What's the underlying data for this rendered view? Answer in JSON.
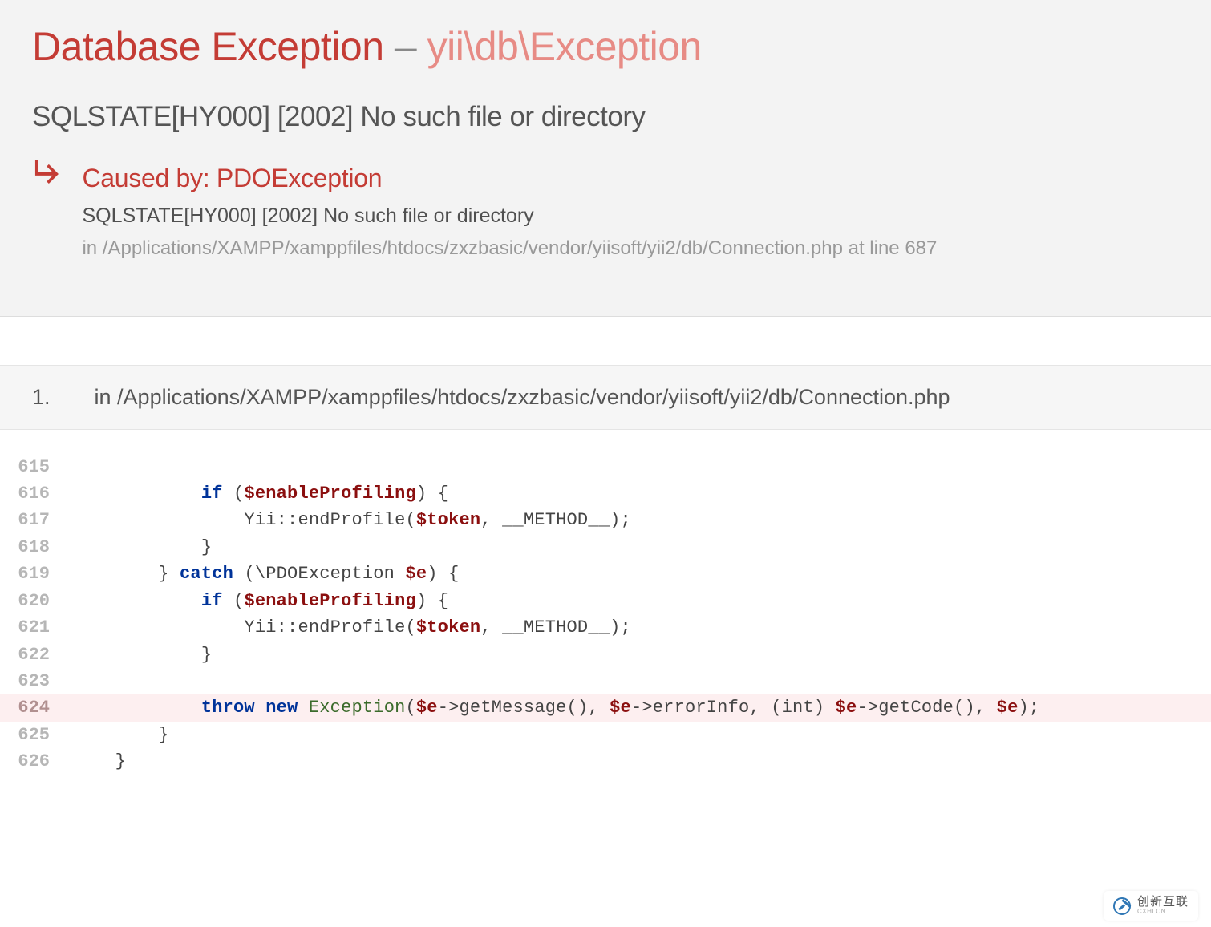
{
  "exception": {
    "name": "Database Exception",
    "separator": " – ",
    "class": "yii\\db\\Exception"
  },
  "message": "SQLSTATE[HY000] [2002] No such file or directory",
  "caused_by": {
    "label": "Caused by: PDOException",
    "message": "SQLSTATE[HY000] [2002] No such file or directory",
    "location": "in /Applications/XAMPP/xamppfiles/htdocs/zxzbasic/vendor/yiisoft/yii2/db/Connection.php at line 687"
  },
  "stack": {
    "index": "1.",
    "in": "in ",
    "path": "/Applications/XAMPP/xamppfiles/htdocs/zxzbasic/vendor/yiisoft/yii2/db/Connection.php"
  },
  "code": {
    "highlight_line": 624,
    "lines": [
      {
        "n": 615,
        "tokens": [
          {
            "t": " ",
            "k": ""
          }
        ]
      },
      {
        "n": 616,
        "tokens": [
          {
            "t": "            ",
            "k": ""
          },
          {
            "t": "if",
            "k": "kw"
          },
          {
            "t": " (",
            "k": ""
          },
          {
            "t": "$enableProfiling",
            "k": "var"
          },
          {
            "t": ") {",
            "k": ""
          }
        ]
      },
      {
        "n": 617,
        "tokens": [
          {
            "t": "                Yii::endProfile(",
            "k": ""
          },
          {
            "t": "$token",
            "k": "var"
          },
          {
            "t": ", __METHOD__);",
            "k": ""
          }
        ]
      },
      {
        "n": 618,
        "tokens": [
          {
            "t": "            }",
            "k": ""
          }
        ]
      },
      {
        "n": 619,
        "tokens": [
          {
            "t": "        } ",
            "k": ""
          },
          {
            "t": "catch",
            "k": "kw"
          },
          {
            "t": " (\\PDOException ",
            "k": ""
          },
          {
            "t": "$e",
            "k": "var"
          },
          {
            "t": ") {",
            "k": ""
          }
        ]
      },
      {
        "n": 620,
        "tokens": [
          {
            "t": "            ",
            "k": ""
          },
          {
            "t": "if",
            "k": "kw"
          },
          {
            "t": " (",
            "k": ""
          },
          {
            "t": "$enableProfiling",
            "k": "var"
          },
          {
            "t": ") {",
            "k": ""
          }
        ]
      },
      {
        "n": 621,
        "tokens": [
          {
            "t": "                Yii::endProfile(",
            "k": ""
          },
          {
            "t": "$token",
            "k": "var"
          },
          {
            "t": ", __METHOD__);",
            "k": ""
          }
        ]
      },
      {
        "n": 622,
        "tokens": [
          {
            "t": "            }",
            "k": ""
          }
        ]
      },
      {
        "n": 623,
        "tokens": [
          {
            "t": " ",
            "k": ""
          }
        ]
      },
      {
        "n": 624,
        "tokens": [
          {
            "t": "            ",
            "k": ""
          },
          {
            "t": "throw",
            "k": "kw"
          },
          {
            "t": " ",
            "k": ""
          },
          {
            "t": "new",
            "k": "kw"
          },
          {
            "t": " ",
            "k": ""
          },
          {
            "t": "Exception",
            "k": "cls"
          },
          {
            "t": "(",
            "k": ""
          },
          {
            "t": "$e",
            "k": "var"
          },
          {
            "t": "->getMessage(), ",
            "k": ""
          },
          {
            "t": "$e",
            "k": "var"
          },
          {
            "t": "->errorInfo, (int) ",
            "k": ""
          },
          {
            "t": "$e",
            "k": "var"
          },
          {
            "t": "->getCode(), ",
            "k": ""
          },
          {
            "t": "$e",
            "k": "var"
          },
          {
            "t": ");",
            "k": ""
          }
        ]
      },
      {
        "n": 625,
        "tokens": [
          {
            "t": "        }",
            "k": ""
          }
        ]
      },
      {
        "n": 626,
        "tokens": [
          {
            "t": "    }",
            "k": ""
          }
        ]
      }
    ]
  },
  "watermark": {
    "cn": "创新互联",
    "en": "CXHLCN"
  }
}
